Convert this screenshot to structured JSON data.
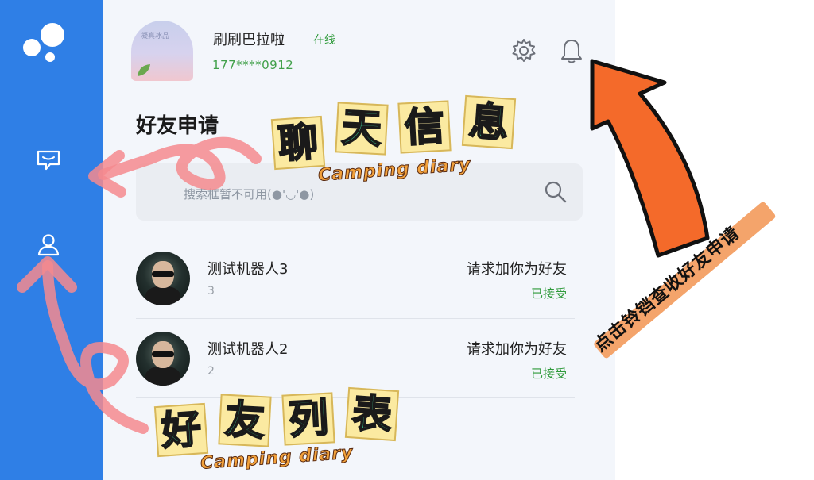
{
  "user": {
    "name": "刷刷巴拉啦",
    "status": "在线",
    "phone": "177****0912",
    "avatar_mark": "凝真冰品"
  },
  "header_icons": [
    "gear-icon",
    "bell-icon"
  ],
  "section_title": "好友申请",
  "search": {
    "placeholder": "搜索框暂不可用(●'◡'●)"
  },
  "requests": [
    {
      "name": "测试机器人3",
      "sub": "3",
      "request": "请求加你为好友",
      "state": "已接受"
    },
    {
      "name": "测试机器人2",
      "sub": "2",
      "request": "请求加你为好友",
      "state": "已接受"
    }
  ],
  "annotations": {
    "chat_sticker": [
      "聊",
      "天",
      "信",
      "息"
    ],
    "chat_sub": "Camping diary",
    "friends_sticker": [
      "好",
      "友",
      "列",
      "表"
    ],
    "friends_sub": "Camping diary",
    "bell_caption": "点击铃铛查收好友申请"
  },
  "colors": {
    "sidebar": "#2f7fe6",
    "online": "#2e9a3a",
    "arrow_orange": "#f46a2a",
    "arrow_pink": "#f48a8e"
  }
}
